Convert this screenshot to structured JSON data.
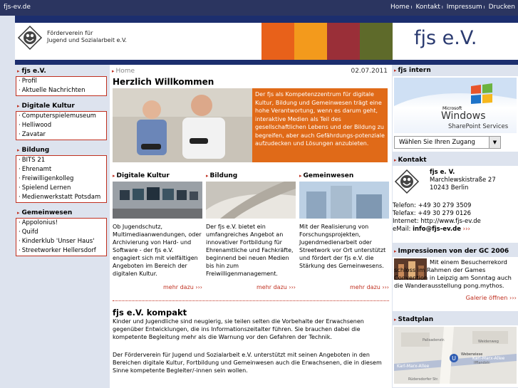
{
  "top": {
    "domain": "fjs-ev.de",
    "links": [
      "Home",
      "Kontakt",
      "Impressum",
      "Drucken"
    ]
  },
  "header": {
    "org_line1": "Förderverein für",
    "org_line2": "Jugend und Sozialarbeit e.V.",
    "brand": "fjs e.V.",
    "block_colors": [
      "#e8611a",
      "#f39a1c",
      "#9a2f38",
      "#5e6a2a"
    ]
  },
  "sidebar": {
    "sections": [
      {
        "title": "fjs e.V.",
        "items": [
          "Profil",
          "Aktuelle Nachrichten"
        ]
      },
      {
        "title": "Digitale Kultur",
        "items": [
          "Computerspielemuseum",
          "Helliwood",
          "Zavatar"
        ]
      },
      {
        "title": "Bildung",
        "items": [
          "BITS 21",
          "Ehrenamt",
          "Freiwilligenkolleg",
          "Spielend Lernen",
          "Medienwerkstatt Potsdam"
        ]
      },
      {
        "title": "Gemeinwesen",
        "items": [
          "Appolonius!",
          "Quifd",
          "Kinderklub 'Unser Haus'",
          "Streetworker Hellersdorf"
        ]
      }
    ]
  },
  "main": {
    "breadcrumb": "Home",
    "date": "02.07.2011",
    "title": "Herzlich Willkommen",
    "hero_text": "Der fjs als Kompetenzzentrum für digitale Kultur, Bildung und Gemeinwesen trägt eine hohe Verantwortung, wenn es darum geht, interaktive Medien als Teil des gesellschaftlichen Lebens und der Bildung zu begreifen, aber auch Gefährdungs-potenziale aufzudecken und Lösungen anzubieten.",
    "columns": [
      {
        "title": "Digitale Kultur",
        "text": "Ob Jugendschutz, Multimediaanwendungen, oder Archivierung von Hard- und Software - der fjs e.V. engagiert sich mit vielfältigen Angeboten im Bereich der digitalen Kultur.",
        "more": "mehr dazu ›››"
      },
      {
        "title": "Bildung",
        "text": "Der fjs e.V. bietet ein umfangreiches Angebot an innovativer Fortbildung für Ehrenamtliche und Fachkräfte, beginnend bei neuen Medien bis hin zum Freiwilligenmanagement.",
        "more": "mehr dazu ›››"
      },
      {
        "title": "Gemeinwesen",
        "text": "Mit der Realisierung von Forschungsprojekten, Jugendmedienarbeit oder Streetwork vor Ort unterstützt und fördert der fjs e.V. die Stärkung des Gemeinwesens.",
        "more": "mehr dazu ›››"
      }
    ],
    "kompakt_title": "fjs e.V. kompakt",
    "kompakt_p1": "Kinder und Jugendliche sind neugierig, sie teilen selten die Vorbehalte der Erwachsenen gegenüber Entwicklungen, die ins Informationszeitalter führen. Sie brauchen dabei die kompetente Begleitung mehr als die Warnung vor den Gefahren der Technik.",
    "kompakt_p2": "Der Förderverein für Jugend und Sozialarbeit e.V. unterstützt mit seinen Angeboten in den Bereichen digitale Kultur, Fortbildung und Gemeinwesen auch die Erwachsenen, die in diesem Sinne kompetente Begleiter/-innen sein wollen."
  },
  "right": {
    "intern_title": "fjs intern",
    "ms_line1": "Microsoft",
    "ms_line2": "Windows",
    "ms_line3": "SharePoint Services",
    "select_value": "Wählen Sie Ihren Zugang",
    "kontakt_title": "Kontakt",
    "contact_name": "fjs e. V.",
    "contact_street": "Marchlewskistraße 27",
    "contact_city": "10243 Berlin",
    "telefon": "Telefon: +49 30 279 3509",
    "telefax": "Telefax: +49 30 279 0126",
    "internet": "Internet: http://www.fjs-ev.de",
    "email_label": "eMail:",
    "email": "info@fjs-ev.de",
    "email_more": "›››",
    "gc_title": "Impressionen von der GC 2006",
    "gc_text": "Mit einem Besucherrekord schloss im Rahmen der Games Convention in Leipzig am Sonntag auch die Wanderausstellung pong.mythos.",
    "gc_more": "Galerie öffnen ›››",
    "stadtplan_title": "Stadtplan",
    "map_labels": [
      "Palisadenstr.",
      "Weidenweg",
      "Karl-Marx-Allee",
      "Weberwiese",
      "Ifflandstr.",
      "Karl-Marx-Allee",
      "Rüdersdorfer Str."
    ],
    "map_marker": "U"
  }
}
